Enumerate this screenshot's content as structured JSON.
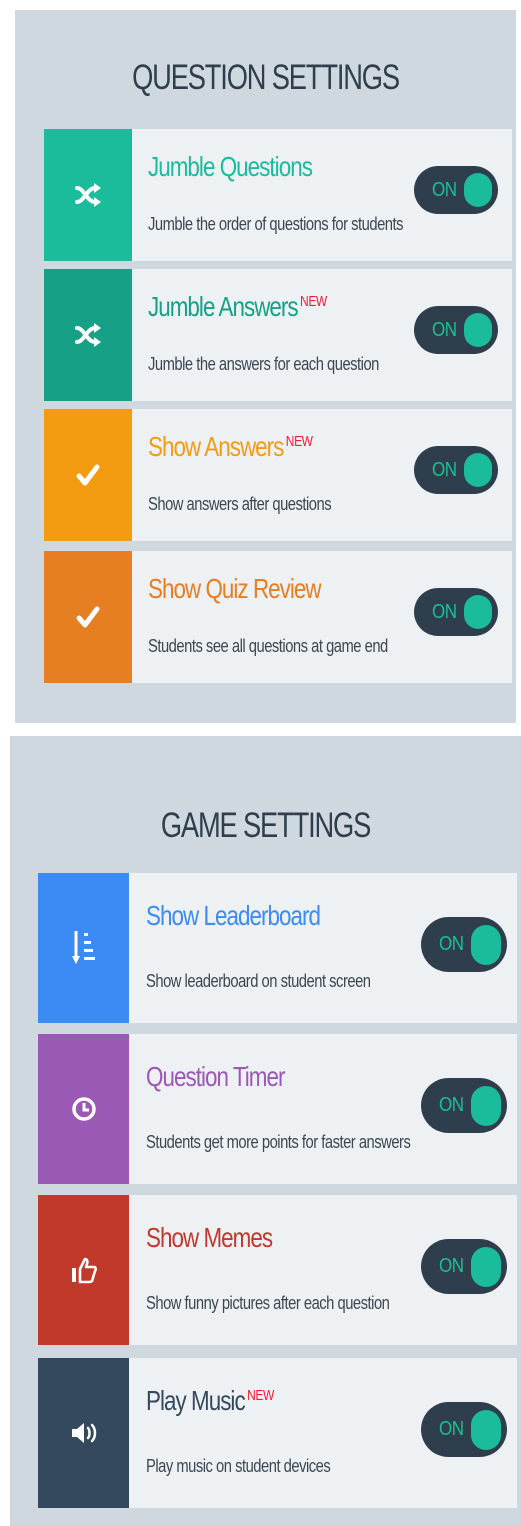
{
  "question_settings": {
    "title": "QUESTION SETTINGS",
    "items": [
      {
        "title": "Jumble Questions",
        "badge": "",
        "desc": "Jumble the order of questions for students",
        "toggle": "ON",
        "color": "#1abc9c",
        "title_color": "#1abc9c",
        "icon": "shuffle-icon"
      },
      {
        "title": "Jumble Answers",
        "badge": "NEW",
        "desc": "Jumble the answers for each question",
        "toggle": "ON",
        "color": "#16a085",
        "title_color": "#16a085",
        "icon": "shuffle-icon"
      },
      {
        "title": "Show Answers",
        "badge": "NEW",
        "desc": "Show answers after questions",
        "toggle": "ON",
        "color": "#f39c12",
        "title_color": "#f39c12",
        "icon": "check-icon"
      },
      {
        "title": "Show Quiz Review",
        "badge": "",
        "desc": "Students see all questions at game end",
        "toggle": "ON",
        "color": "#e67e22",
        "title_color": "#e67e22",
        "icon": "check-icon"
      }
    ]
  },
  "game_settings": {
    "title": "GAME SETTINGS",
    "items": [
      {
        "title": "Show Leaderboard",
        "badge": "",
        "desc": "Show leaderboard on student screen",
        "toggle": "ON",
        "color": "#3c8bf4",
        "title_color": "#3c8bf4",
        "icon": "leaderboard-icon"
      },
      {
        "title": "Question Timer",
        "badge": "",
        "desc": "Students get more points for faster answers",
        "toggle": "ON",
        "color": "#9b59b6",
        "title_color": "#9b59b6",
        "icon": "clock-icon"
      },
      {
        "title": "Show Memes",
        "badge": "",
        "desc": "Show funny pictures after each question",
        "toggle": "ON",
        "color": "#c0392b",
        "title_color": "#c0392b",
        "icon": "thumbs-up-icon"
      },
      {
        "title": "Play Music",
        "badge": "NEW",
        "desc": "Play music on student devices",
        "toggle": "ON",
        "color": "#34495e",
        "title_color": "#34495e",
        "icon": "speaker-icon"
      }
    ]
  }
}
